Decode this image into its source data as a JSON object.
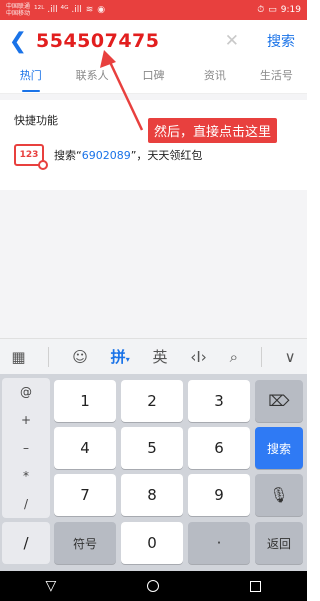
{
  "status_bar": {
    "carrier_top": "中国联通",
    "carrier_bottom": "中国移动",
    "signal": "¹²ᴸ .ill ⁴ᴳ .ill",
    "time": "9:19"
  },
  "header": {
    "back_icon": "back-icon",
    "query": "554507475",
    "search_label": "搜索"
  },
  "tabs": [
    {
      "label": "热门"
    },
    {
      "label": "联系人"
    },
    {
      "label": "口碑"
    },
    {
      "label": "资讯"
    },
    {
      "label": "生活号"
    }
  ],
  "quick": {
    "title": "快捷功能",
    "icon_text": "123",
    "item_prefix": "搜索“",
    "item_code": "6902089",
    "item_suffix": "”，天天领红包"
  },
  "annotation": {
    "text": "然后，直接点击这里",
    "color": "#e8403e"
  },
  "ime": {
    "items": [
      "▦",
      "☺",
      "拼",
      "英",
      "‹I›",
      "⌕",
      "∨"
    ]
  },
  "keyboard": {
    "side": [
      "@",
      "+",
      "–",
      "*",
      "/"
    ],
    "rows": [
      [
        "1",
        "2",
        "3"
      ],
      [
        "4",
        "5",
        "6"
      ],
      [
        "7",
        "8",
        "9"
      ]
    ],
    "fuhao": "符号",
    "zero": "0",
    "dot": "·",
    "search": "搜索",
    "back": "返回"
  },
  "navbar": {
    "back": "▽"
  }
}
